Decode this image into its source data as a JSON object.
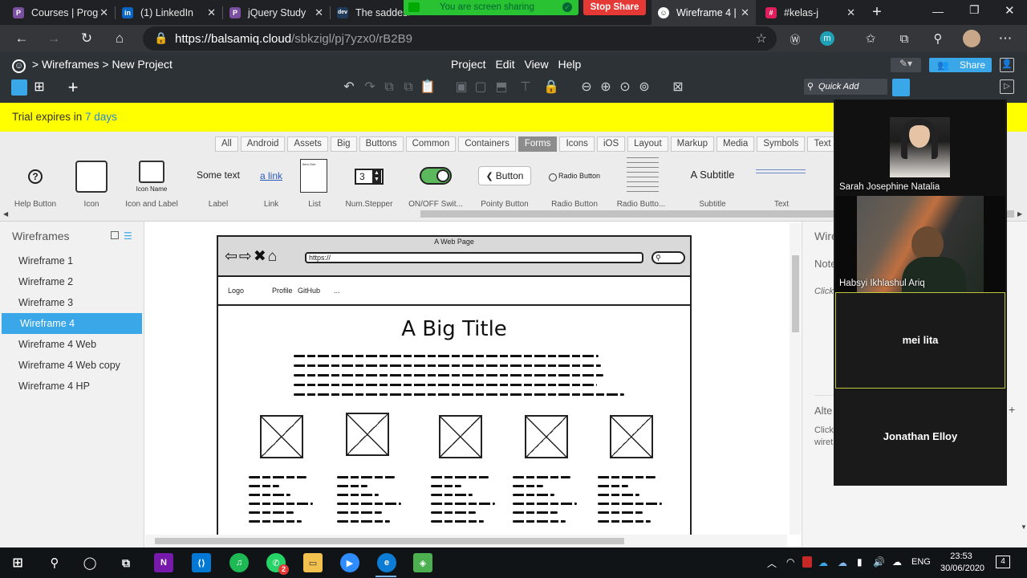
{
  "browser": {
    "tabs": [
      {
        "title": "Courses | Prog",
        "icon": "p-icon",
        "color": "#7b4fa0"
      },
      {
        "title": "(1) LinkedIn",
        "icon": "linkedin-icon",
        "color": "#0a66c2"
      },
      {
        "title": "jQuery Study",
        "icon": "p-icon",
        "color": "#7b4fa0"
      },
      {
        "title": "The saddest",
        "icon": "dev-icon",
        "color": "#1f3a5a"
      },
      {
        "title": "Wireframe 4 |",
        "icon": "balsamiq-icon",
        "color": "#ffffff",
        "active": true
      },
      {
        "title": "#kelas-j",
        "icon": "slack-icon",
        "color": "#e01e5a"
      }
    ],
    "url_base": "https://balsamiq.cloud",
    "url_path": "/sbkzigl/pj7yzx0/rB2B9",
    "avatar_initial": "m"
  },
  "share": {
    "status": "You are screen sharing",
    "stop": "Stop Share"
  },
  "app": {
    "breadcrumb": "> Wireframes > New Project",
    "menu": [
      "Project",
      "Edit",
      "View",
      "Help"
    ],
    "quick_add": "Quick Add",
    "share_label": "Share"
  },
  "trial": {
    "text": "Trial expires in",
    "days": "7 days"
  },
  "library": {
    "categories": [
      "All",
      "Android",
      "Assets",
      "Big",
      "Buttons",
      "Common",
      "Containers",
      "Forms",
      "Icons",
      "iOS",
      "Layout",
      "Markup",
      "Media",
      "Symbols",
      "Text"
    ],
    "selected": "Forms",
    "components": [
      {
        "name": "Help Button",
        "preview": "?"
      },
      {
        "name": "Icon",
        "preview": ""
      },
      {
        "name": "Icon and Label",
        "preview": "Icon Name"
      },
      {
        "name": "Label",
        "preview": "Some text"
      },
      {
        "name": "Link",
        "preview": "a link"
      },
      {
        "name": "List",
        "preview": "Item One"
      },
      {
        "name": "Num.Stepper",
        "preview": "3"
      },
      {
        "name": "ON/OFF Swit...",
        "preview": ""
      },
      {
        "name": "Pointy Button",
        "preview": "Button"
      },
      {
        "name": "Radio Button",
        "preview": "Radio Button"
      },
      {
        "name": "Radio Butto...",
        "preview": ""
      },
      {
        "name": "Subtitle",
        "preview": "A Subtitle"
      },
      {
        "name": "Text",
        "preview": ""
      }
    ]
  },
  "wireframes": {
    "header": "Wireframes",
    "items": [
      "Wireframe 1",
      "Wireframe 2",
      "Wireframe 3",
      "Wireframe 4",
      "Wireframe 4 Web",
      "Wireframe 4 Web copy",
      "Wireframe 4 HP"
    ],
    "selected": "Wireframe 4"
  },
  "mockup": {
    "page_title": "A Web Page",
    "url": "https://",
    "nav": [
      "Logo",
      "Profile",
      "GitHub",
      "..."
    ],
    "title": "A Big Title"
  },
  "right_panel": {
    "title": "Wire",
    "notes": "Note",
    "click": "Click",
    "alt": "Alte",
    "click2": "Click",
    "wire2": "wiret"
  },
  "meeting": {
    "participants": [
      {
        "name": "Sarah Josephine Natalia",
        "video": true
      },
      {
        "name": "Habsyi Ikhlashul Ariq",
        "video": true
      },
      {
        "name": "mei lita",
        "video": false
      },
      {
        "name": "Jonathan Elloy",
        "video": false
      }
    ]
  },
  "taskbar": {
    "time": "23:53",
    "date": "30/06/2020",
    "language": "ENG",
    "whatsapp_badge": "2",
    "notifications": "4"
  }
}
